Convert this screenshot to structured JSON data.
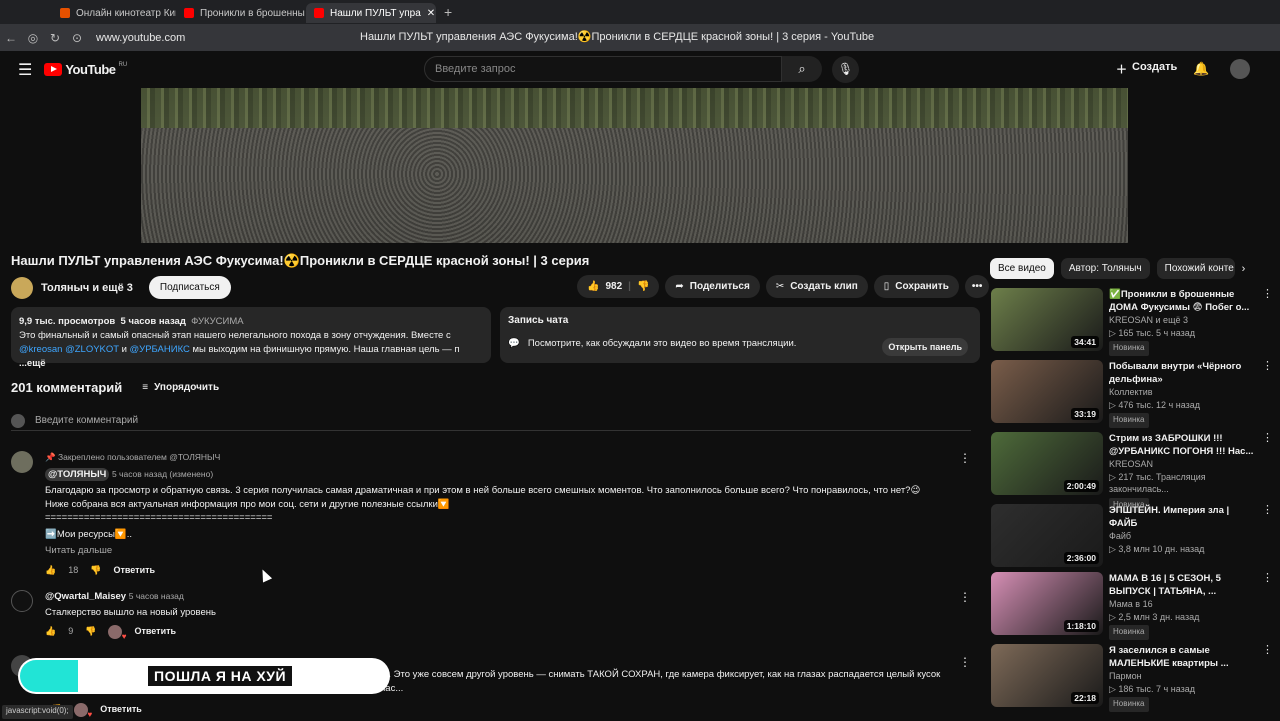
{
  "browser": {
    "tabs": [
      {
        "label": "Онлайн кинотеатр Кино",
        "color": "#e65100"
      },
      {
        "label": "Проникли в брошенны",
        "color": "#ff0000"
      },
      {
        "label": "Нашли ПУЛЬТ упра",
        "color": "#ff0000"
      }
    ],
    "url": "www.youtube.com",
    "window_title": "Нашли ПУЛЬТ управления АЭС Фукусима!☢️Проникли в СЕРДЦЕ красной зоны! | 3 серия - YouTube"
  },
  "header": {
    "logo": "YouTube",
    "logo_region": "RU",
    "search_placeholder": "Введите запрос",
    "create_label": "Создать"
  },
  "video": {
    "title": "Нашли ПУЛЬТ управления АЭС Фукусима!☢️Проникли в СЕРДЦЕ красной зоны! | 3 серия",
    "channel": "Толяныч и ещё 3",
    "subscribe": "Подписаться",
    "likes": "982",
    "share": "Поделиться",
    "clip": "Создать клип",
    "save": "Сохранить"
  },
  "description": {
    "views": "9,9 тыс. просмотров",
    "time": "5 часов назад",
    "tag": "ФУКУСИМА",
    "text": "Это финальный и самый опасный этап нашего нелегального похода в зону отчуждения. Вместе с",
    "link1": "@kreosan",
    "link2": "@ZLOYKOT",
    "and": "и",
    "link3": "@УРБАНИКС",
    "text2": "мы выходим на финишную прямую. Наша главная цель — п",
    "more": "...ещё"
  },
  "chat": {
    "heading": "Запись чата",
    "text": "Посмотрите, как обсуждали это видео во время трансляции.",
    "open_panel": "Открыть панель"
  },
  "comments": {
    "count": "201 комментарий",
    "sort": "Упорядочить",
    "add_placeholder": "Введите комментарий",
    "items": [
      {
        "pinned": "Закреплено пользователем @ТОЛЯНЫЧ",
        "author": "@ТОЛЯНЫЧ",
        "time": "5 часов назад (изменено)",
        "line1": "Благодарю за просмотр и обратную связь. 3 серия получилась самая драматичная и при этом в ней больше всего смешных моментов. Что заполнилось больше всего? Что понравилось, что нет?😉",
        "line2": "Ниже собрана вся актуальная информация про мои соц. сети и другие полезные ссылки🔽",
        "line3": "=========================================",
        "line4": "➡️Мои ресурсы🔽..",
        "read_more": "Читать дальше",
        "likes": "18",
        "reply": "Ответить"
      },
      {
        "author": "@Qwartal_Maisey",
        "time": "5 часов назад",
        "text": "Сталкерство вышло на новый уровень",
        "likes": "9",
        "reply": "Ответить"
      },
      {
        "text": "льше. Это уже совсем другой уровень — снимать ТАКОЙ СОХРАН, где камера фиксирует, как на глазах распадается целый кусок",
        "text2": "сейчас...",
        "reply": "Ответить"
      }
    ]
  },
  "sidebar": {
    "chips": [
      "Все видео",
      "Автор: Толяныч",
      "Похожий конте"
    ],
    "recommendations": [
      {
        "title": "✅Проникли в брошенные ДОМА Фукусимы 😨 Побег о...",
        "channel": "KREOSAN",
        "channel_extra": "и ещё 3",
        "meta": "▷ 165 тыс.  5 ч назад",
        "badge": "Новинка",
        "duration": "34:41",
        "thumb": "#6d7f4a"
      },
      {
        "title": "Побывали внутри «Чёрного дельфина»",
        "channel": "Коллектив",
        "channel_extra": "",
        "meta": "▷ 476 тыс.  12 ч назад",
        "badge": "Новинка",
        "duration": "33:19",
        "thumb": "#7a5d4a"
      },
      {
        "title": "Стрим из ЗАБРОШКИ !!! @УРБАНИКС  ПОГОНЯ !!! Нас...",
        "channel": "KREOSAN",
        "channel_extra": "",
        "meta": "▷ 217 тыс.  Трансляция закончилась...",
        "badge": "Новинка",
        "duration": "2:00:49",
        "thumb": "#4e6b3a"
      },
      {
        "title": "ЭПШТЕЙН. Империя зла | ФАЙБ",
        "channel": "Файб",
        "channel_extra": "",
        "meta": "▷ 3,8 млн  10 дн. назад",
        "badge": "",
        "duration": "2:36:00",
        "thumb": "#2e2e2e"
      },
      {
        "title": "МАМА В 16 | 5 СЕЗОН, 5 ВЫПУСК | ТАТЬЯНА, ...",
        "channel": "Мама в 16",
        "channel_extra": "",
        "meta": "▷ 2,5 млн  3 дн. назад",
        "badge": "Новинка",
        "duration": "1:18:10",
        "thumb": "#d68fb5"
      },
      {
        "title": "Я заселился в самые МАЛЕНЬКИЕ квартиры ...",
        "channel": "Пармон",
        "channel_extra": "",
        "meta": "▷ 186 тыс.  7 ч назад",
        "badge": "Новинка",
        "duration": "22:18",
        "thumb": "#7e6a58"
      }
    ]
  },
  "overlay_text": "ПОШЛА Я НА ХУЙ",
  "status_text": "javascript:void(0);"
}
